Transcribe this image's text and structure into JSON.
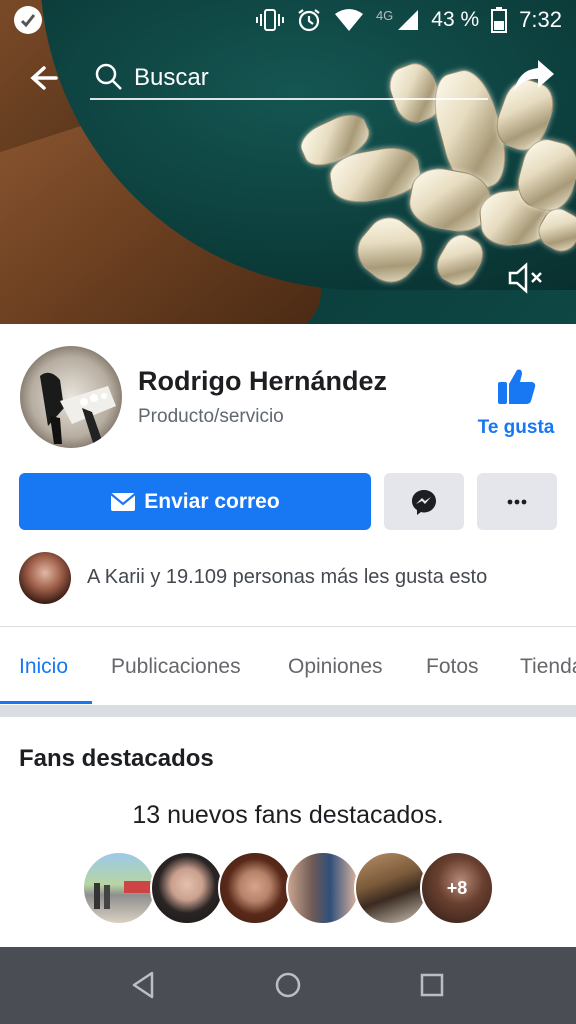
{
  "status_bar": {
    "network": "4G",
    "battery": "43 %",
    "time": "7:32"
  },
  "topbar": {
    "search_placeholder": "Buscar"
  },
  "profile": {
    "name": "Rodrigo Hernández",
    "category": "Producto/servicio",
    "like_label": "Te gusta"
  },
  "actions": {
    "email_label": "Enviar correo"
  },
  "likes": {
    "text": "A Karii y 19.109 personas más les gusta esto"
  },
  "tabs": [
    {
      "label": "Inicio",
      "active": true
    },
    {
      "label": "Publicaciones",
      "active": false
    },
    {
      "label": "Opiniones",
      "active": false
    },
    {
      "label": "Fotos",
      "active": false
    },
    {
      "label": "Tienda",
      "active": false
    }
  ],
  "fans": {
    "title": "Fans destacados",
    "subtitle": "13 nuevos fans destacados.",
    "more_label": "+8"
  },
  "colors": {
    "accent": "#1877f2",
    "nav_bar": "#4a4e54"
  }
}
